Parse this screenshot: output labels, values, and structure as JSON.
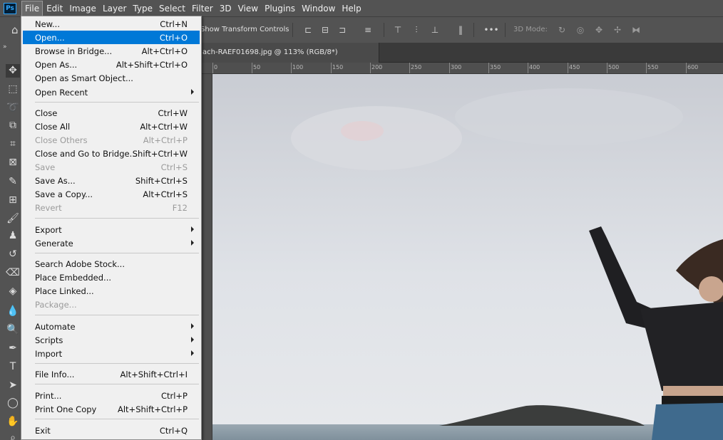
{
  "menubar": {
    "logo": "Ps",
    "items": [
      "File",
      "Edit",
      "Image",
      "Layer",
      "Type",
      "Select",
      "Filter",
      "3D",
      "View",
      "Plugins",
      "Window",
      "Help"
    ]
  },
  "options_bar": {
    "show_transform_controls": "Show Transform Controls",
    "mode_label": "3D Mode:",
    "more_glyph": "•••"
  },
  "tools": {
    "collapse_glyph": "»"
  },
  "document_tab": {
    "title": "ach-RAEF01698.jpg @ 113% (RGB/8*)"
  },
  "ruler": {
    "labels": [
      "0",
      "50",
      "100",
      "150",
      "200",
      "250",
      "300",
      "350",
      "400",
      "450",
      "500",
      "550",
      "600"
    ]
  },
  "file_menu": {
    "items": [
      {
        "label": "New...",
        "shortcut": "Ctrl+N"
      },
      {
        "label": "Open...",
        "shortcut": "Ctrl+O",
        "highlighted": true
      },
      {
        "label": "Browse in Bridge...",
        "shortcut": "Alt+Ctrl+O"
      },
      {
        "label": "Open As...",
        "shortcut": "Alt+Shift+Ctrl+O"
      },
      {
        "label": "Open as Smart Object...",
        "shortcut": ""
      },
      {
        "label": "Open Recent",
        "shortcut": "",
        "submenu": true
      },
      {
        "label": "Close",
        "shortcut": "Ctrl+W"
      },
      {
        "label": "Close All",
        "shortcut": "Alt+Ctrl+W"
      },
      {
        "label": "Close Others",
        "shortcut": "Alt+Ctrl+P",
        "disabled": true
      },
      {
        "label": "Close and Go to Bridge...",
        "shortcut": "Shift+Ctrl+W"
      },
      {
        "label": "Save",
        "shortcut": "Ctrl+S",
        "disabled": true
      },
      {
        "label": "Save As...",
        "shortcut": "Shift+Ctrl+S"
      },
      {
        "label": "Save a Copy...",
        "shortcut": "Alt+Ctrl+S"
      },
      {
        "label": "Revert",
        "shortcut": "F12",
        "disabled": true
      },
      {
        "label": "Export",
        "shortcut": "",
        "submenu": true
      },
      {
        "label": "Generate",
        "shortcut": "",
        "submenu": true
      },
      {
        "label": "Search Adobe Stock...",
        "shortcut": ""
      },
      {
        "label": "Place Embedded...",
        "shortcut": ""
      },
      {
        "label": "Place Linked...",
        "shortcut": ""
      },
      {
        "label": "Package...",
        "shortcut": "",
        "disabled": true
      },
      {
        "label": "Automate",
        "shortcut": "",
        "submenu": true
      },
      {
        "label": "Scripts",
        "shortcut": "",
        "submenu": true
      },
      {
        "label": "Import",
        "shortcut": "",
        "submenu": true
      },
      {
        "label": "File Info...",
        "shortcut": "Alt+Shift+Ctrl+I"
      },
      {
        "label": "Print...",
        "shortcut": "Ctrl+P"
      },
      {
        "label": "Print One Copy",
        "shortcut": "Alt+Shift+Ctrl+P"
      },
      {
        "label": "Exit",
        "shortcut": "Ctrl+Q"
      }
    ]
  },
  "colors": {
    "highlight": "#0078d7",
    "chrome": "#535353",
    "workspace": "#282828"
  }
}
